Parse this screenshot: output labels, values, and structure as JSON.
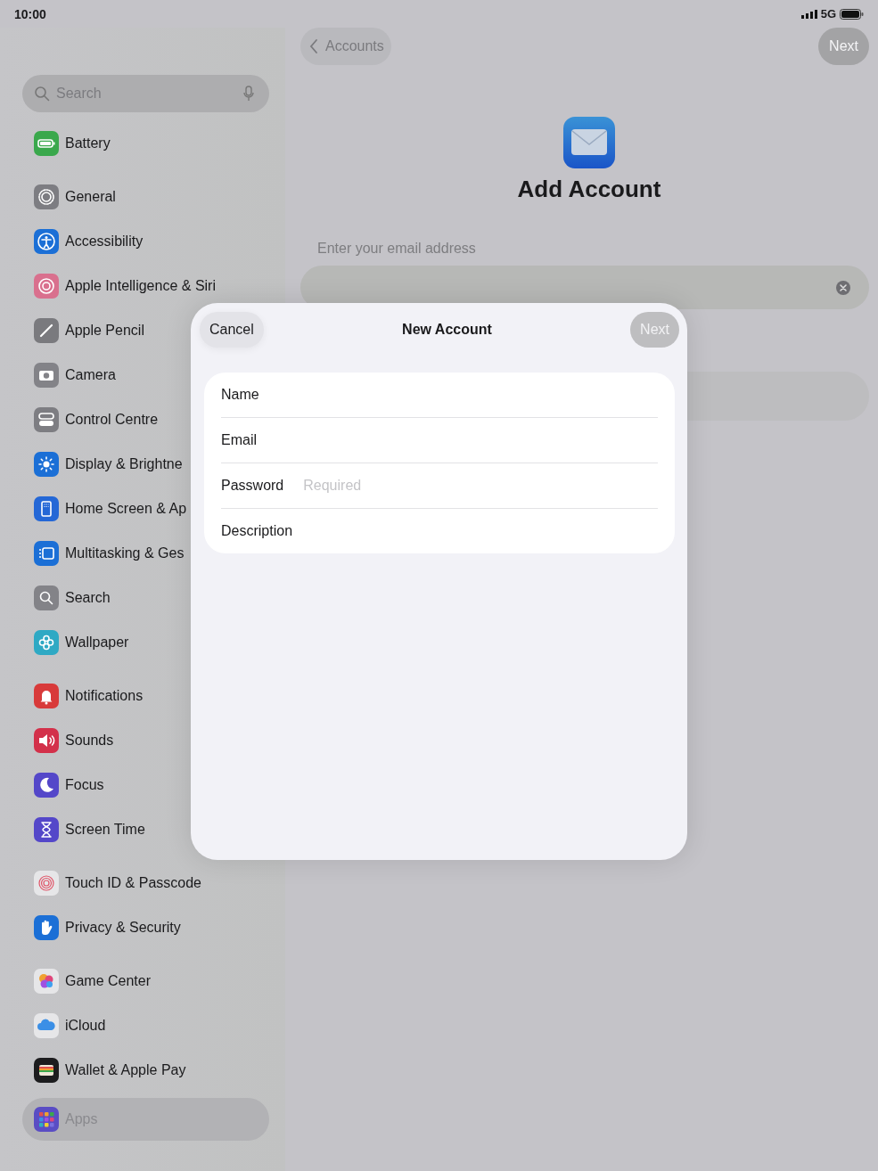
{
  "status_bar": {
    "time": "10:00",
    "network": "5G"
  },
  "sidebar": {
    "search": {
      "placeholder": "Search"
    },
    "groups": [
      {
        "items": [
          {
            "label": "Battery",
            "color": "#3aa84c"
          }
        ]
      },
      {
        "items": [
          {
            "label": "General",
            "color": "#7d7d82"
          },
          {
            "label": "Accessibility",
            "color": "#1b6fd6"
          },
          {
            "label": "Apple Intelligence & Siri",
            "color": "#d9708e"
          },
          {
            "label": "Apple Pencil",
            "color": "#7a7a7e"
          },
          {
            "label": "Camera",
            "color": "#838388"
          },
          {
            "label": "Control Centre",
            "color": "#7d7d82"
          },
          {
            "label": "Display & Brightne",
            "color": "#1b6fd6"
          },
          {
            "label": "Home Screen & Ap",
            "color": "#2467d6"
          },
          {
            "label": "Multitasking & Ges",
            "color": "#1b6fd6"
          },
          {
            "label": "Search",
            "color": "#838388"
          },
          {
            "label": "Wallpaper",
            "color": "#2fa9c4"
          }
        ]
      },
      {
        "items": [
          {
            "label": "Notifications",
            "color": "#d83a3a"
          },
          {
            "label": "Sounds",
            "color": "#d3304a"
          },
          {
            "label": "Focus",
            "color": "#5447c9"
          },
          {
            "label": "Screen Time",
            "color": "#5447c9"
          }
        ]
      },
      {
        "items": [
          {
            "label": "Touch ID & Passcode",
            "color": "#e6e6e8"
          },
          {
            "label": "Privacy & Security",
            "color": "#1b6fd6"
          }
        ]
      },
      {
        "items": [
          {
            "label": "Game Center",
            "color": "#e6e6e8"
          },
          {
            "label": "iCloud",
            "color": "#e6e6e8"
          },
          {
            "label": "Wallet & Apple Pay",
            "color": "#1c1c1e"
          }
        ]
      }
    ],
    "apps_button": {
      "label": "Apps"
    }
  },
  "nav": {
    "back_button": "Accounts",
    "next_button": {
      "label": "Next",
      "disabled": true
    }
  },
  "title": "Add Account",
  "email_label": "Enter your email address",
  "modal": {
    "cancel_button": "Cancel",
    "title": "New Account",
    "next_button": {
      "label": "Next",
      "disabled": true
    },
    "fields": [
      {
        "label": "Name"
      },
      {
        "label": "Email"
      },
      {
        "label": "Password",
        "placeholder": "Required"
      },
      {
        "label": "Description"
      }
    ]
  }
}
